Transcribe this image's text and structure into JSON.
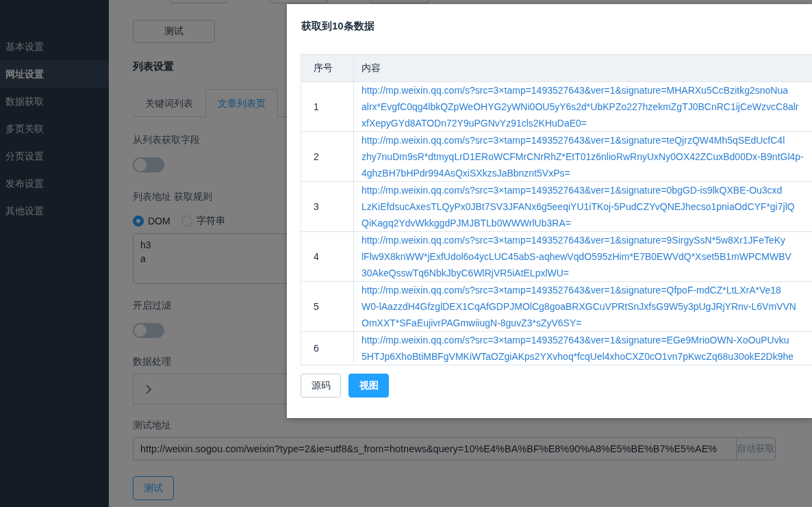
{
  "sidebar": {
    "items": [
      {
        "label": "基本设置",
        "selected": false
      },
      {
        "label": "网址设置",
        "selected": true
      },
      {
        "label": "数据获取",
        "selected": false
      },
      {
        "label": "多页关联",
        "selected": false
      },
      {
        "label": "分页设置",
        "selected": false
      },
      {
        "label": "发布设置",
        "selected": false
      },
      {
        "label": "其他设置",
        "selected": false
      }
    ]
  },
  "top_test_button": {
    "label": "测试",
    "focused": false
  },
  "list_settings": {
    "title": "列表设置",
    "tabs": [
      {
        "label": "关键词列表",
        "selected": false
      },
      {
        "label": "文章列表页",
        "selected": true
      }
    ]
  },
  "fetch_fields": {
    "label": "从列表获取字段",
    "on": false
  },
  "list_rule": {
    "label": "列表地址 获取规则",
    "options": [
      {
        "label": "DOM",
        "selected": true
      },
      {
        "label": "字符串",
        "selected": false
      }
    ],
    "value": "h3\na"
  },
  "filter": {
    "label": "开启过滤",
    "on": false
  },
  "data_processing": {
    "label": "数据处理",
    "expanded": false
  },
  "test_url": {
    "label": "测试地址",
    "value": "http://weixin.sogou.com/weixin?type=2&ie=utf8&s_from=hotnews&query=10%E4%BA%BF%E8%90%A8%E5%BE%B7%E5%AE%",
    "button": "自动获取"
  },
  "test_button": {
    "label": "测试",
    "focused": true
  },
  "dialog": {
    "title": "获取到10条数据",
    "table": {
      "columns": [
        "序号",
        "内容"
      ],
      "rows": [
        {
          "index": "1",
          "content": [
            "http://mp.weixin.qq.com/s?src=3×tamp=1493527643&ver=1&signature=MHARXu5CcBzitkg2snoNua",
            "alrx*EvgfC0qg4lbkQZpWeOHYG2yWNi0OU5yY6s2d*UbKPZo227hzekmZgTJ0BCnRC1ijCeWzvcC8alr",
            "xfXepyGYd8ATODn72Y9uPGNvYz91cls2KHuDaE0="
          ]
        },
        {
          "index": "2",
          "content": [
            "http://mp.weixin.qq.com/s?src=3×tamp=1493527643&ver=1&signature=teQjrzQW4Mh5qSEdUcfC4l",
            "zhy7nuDm9sR*dtmyqLrD1ERoWCFMrCNrRhZ*EtT01z6nlioRwRnyUxNy0OX42ZCuxBd00Dx-B9ntGl4p-",
            "4ghzBH7bHPdr994AsQxiSXkzsJaBbnznt5VxPs="
          ]
        },
        {
          "index": "3",
          "content": [
            "http://mp.weixin.qq.com/s?src=3×tamp=1493527643&ver=1&signature=0bgGD-is9lkQXBE-Ou3cxd",
            "LzKiEfdsucAxesTLQyPx0JBt7SV3JFANx6g5eeqiYU1iTKoj-5PudCZYvQNEJhecso1pniaOdCYF*gi7jlQ",
            "QiKagq2YdvWkkggdPJMJBTLb0WWWrlUb3RA="
          ]
        },
        {
          "index": "4",
          "content": [
            "http://mp.weixin.qq.com/s?src=3×tamp=1493527643&ver=1&signature=9SirgySsN*5w8Xr1JFeTeKy",
            "lFlw9X8knWW*jExfUdol6o4ycLUC45abS-aqhewVqdO595zHim*E7B0EWVdQ*Xset5B1mWPCMWBV",
            "30AkeQsswTq6NbkJbyC6WlRjVR5iAtELpxlWU="
          ]
        },
        {
          "index": "5",
          "content": [
            "http://mp.weixin.qq.com/s?src=3×tamp=1493527643&ver=1&signature=QfpoF-mdCZ*LtLXrA*Ve18",
            "W0-lAazzdH4GfzglDEX1CqAfGDPJMOlCg8goaBRXGCuVPRtSnJxfsG9W5y3pUgJRjYRnv-L6VmVVN",
            "OmXXT*SFaEujivrPAGmwiiugN-8guvZ3*sZyV6SY="
          ]
        },
        {
          "index": "6",
          "content": [
            "http://mp.weixin.qq.com/s?src=3×tamp=1493527643&ver=1&signature=EGe9MrioOWN-XoOuPUvku",
            "5HTJp6XhoBtiMBFgVMKiWTaOZgiAKps2YXvhoq*fcqUel4xhoCXZ0cO1vn7pKwcZq68u30okE2Dk9he"
          ]
        }
      ]
    },
    "buttons": [
      {
        "label": "源码",
        "selected": false
      },
      {
        "label": "视图",
        "selected": true
      }
    ]
  }
}
